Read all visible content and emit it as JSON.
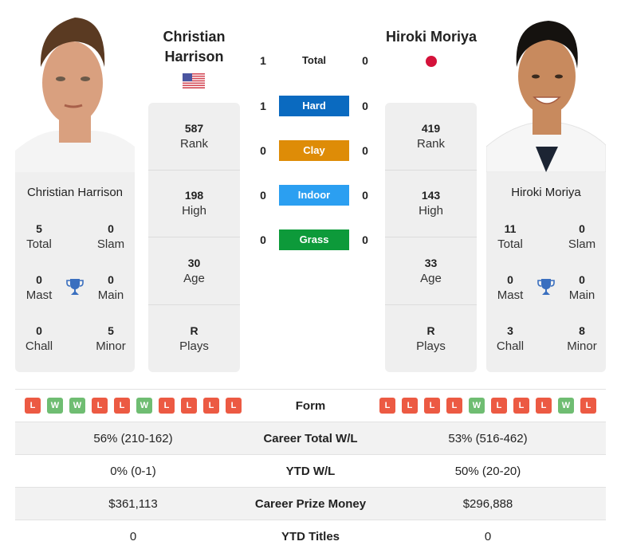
{
  "players": {
    "left": {
      "name": "Christian Harrison",
      "name_line1": "Christian",
      "name_line2": "Harrison",
      "country": "USA",
      "flag_icon": "us-flag-icon",
      "stats": [
        {
          "value": "587",
          "label": "Rank"
        },
        {
          "value": "198",
          "label": "High"
        },
        {
          "value": "30",
          "label": "Age"
        },
        {
          "value": "R",
          "label": "Plays"
        }
      ],
      "titles": {
        "total": {
          "value": "5",
          "label": "Total"
        },
        "slam": {
          "value": "0",
          "label": "Slam"
        },
        "mast": {
          "value": "0",
          "label": "Mast"
        },
        "main": {
          "value": "0",
          "label": "Main"
        },
        "chall": {
          "value": "0",
          "label": "Chall"
        },
        "minor": {
          "value": "5",
          "label": "Minor"
        }
      },
      "form": [
        "L",
        "W",
        "W",
        "L",
        "L",
        "W",
        "L",
        "L",
        "L",
        "L"
      ],
      "career_total_wl": "56% (210-162)",
      "ytd_wl": "0% (0-1)",
      "career_prize_money": "$361,113",
      "ytd_titles": "0"
    },
    "right": {
      "name": "Hiroki Moriya",
      "country": "Japan",
      "flag_icon": "japan-flag-icon",
      "stats": [
        {
          "value": "419",
          "label": "Rank"
        },
        {
          "value": "143",
          "label": "High"
        },
        {
          "value": "33",
          "label": "Age"
        },
        {
          "value": "R",
          "label": "Plays"
        }
      ],
      "titles": {
        "total": {
          "value": "11",
          "label": "Total"
        },
        "slam": {
          "value": "0",
          "label": "Slam"
        },
        "mast": {
          "value": "0",
          "label": "Mast"
        },
        "main": {
          "value": "0",
          "label": "Main"
        },
        "chall": {
          "value": "3",
          "label": "Chall"
        },
        "minor": {
          "value": "8",
          "label": "Minor"
        }
      },
      "form": [
        "L",
        "L",
        "L",
        "L",
        "W",
        "L",
        "L",
        "L",
        "W",
        "L"
      ],
      "career_total_wl": "53% (516-462)",
      "ytd_wl": "50% (20-20)",
      "career_prize_money": "$296,888",
      "ytd_titles": "0"
    }
  },
  "h2h": [
    {
      "label": "Total",
      "left": "1",
      "right": "0",
      "color": null
    },
    {
      "label": "Hard",
      "left": "1",
      "right": "0",
      "color": "#0a6ac0"
    },
    {
      "label": "Clay",
      "left": "0",
      "right": "0",
      "color": "#de8c07"
    },
    {
      "label": "Indoor",
      "left": "0",
      "right": "0",
      "color": "#2b9ff1"
    },
    {
      "label": "Grass",
      "left": "0",
      "right": "0",
      "color": "#0d9a3a"
    }
  ],
  "comparison": {
    "form_label": "Form",
    "career_total_wl_label": "Career Total W/L",
    "ytd_wl_label": "YTD W/L",
    "career_prize_money_label": "Career Prize Money",
    "ytd_titles_label": "YTD Titles"
  },
  "colors": {
    "loss": "#ec5a43",
    "win": "#6fbd72",
    "trophy": "#3a6fbf",
    "japan_red": "#d4123a"
  }
}
